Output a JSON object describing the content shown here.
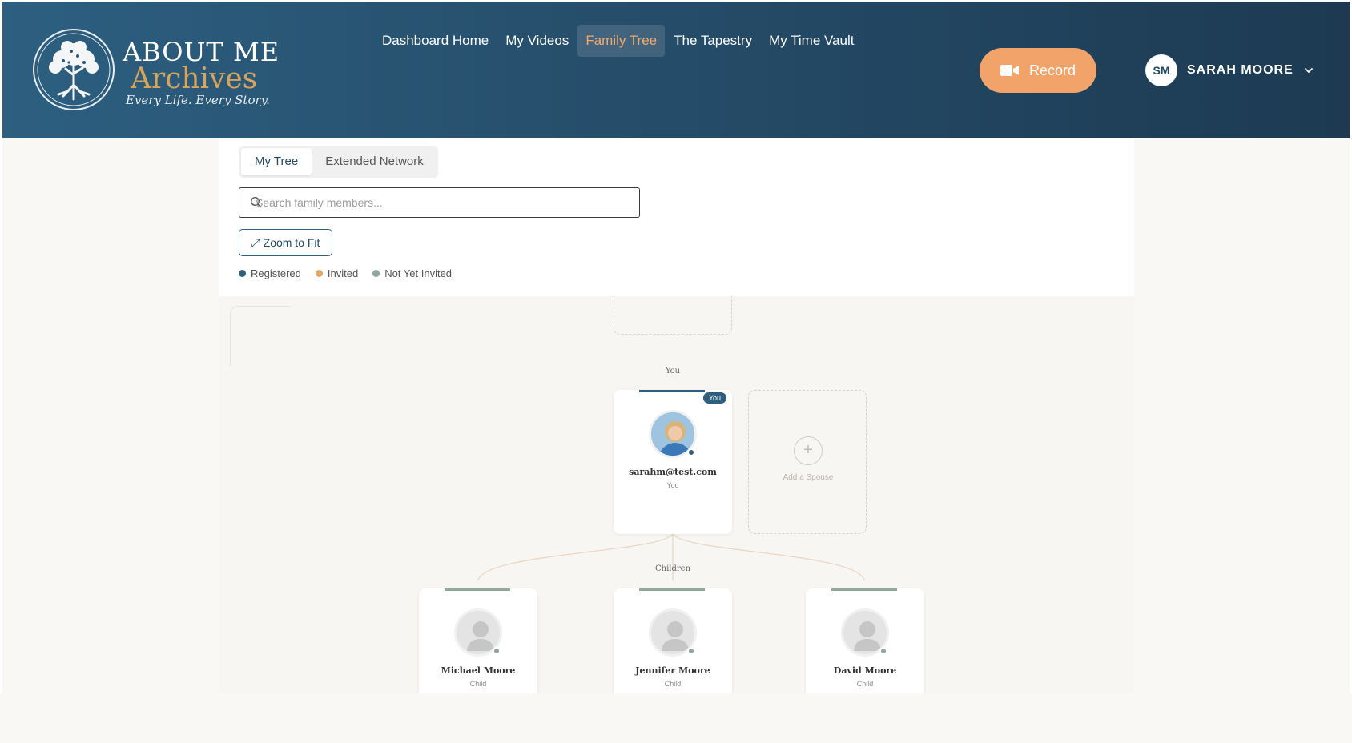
{
  "brand": {
    "line1": "ABOUT ME",
    "line2": "Archives",
    "tagline": "Every Life. Every Story."
  },
  "nav": {
    "items": [
      {
        "label": "Dashboard Home"
      },
      {
        "label": "My Videos"
      },
      {
        "label": "Family Tree",
        "active": true
      },
      {
        "label": "The Tapestry"
      },
      {
        "label": "My Time Vault"
      }
    ]
  },
  "record": {
    "label": "Record",
    "icon": "video-camera-icon"
  },
  "user": {
    "initials": "SM",
    "name": "SARAH MOORE",
    "menu_icon": "chevron-down-icon"
  },
  "tree": {
    "tabs": [
      {
        "label": "My Tree",
        "active": true
      },
      {
        "label": "Extended Network"
      }
    ],
    "search": {
      "placeholder": "Search family members..."
    },
    "zoom_label": "⤢ Zoom to Fit",
    "legend": [
      {
        "label": "Registered",
        "color": "#2f5f7e"
      },
      {
        "label": "Invited",
        "color": "#e0a868"
      },
      {
        "label": "Not Yet Invited",
        "color": "#8fa89b"
      }
    ],
    "you_section_label": "You",
    "children_section_label": "Children",
    "self_card": {
      "name": "sarahm@test.com",
      "role": "You",
      "badge": "You",
      "status": "Registered"
    },
    "add_spouse_label": "Add a Spouse",
    "children": [
      {
        "name": "Michael Moore",
        "role": "Child",
        "status": "Not Yet Invited"
      },
      {
        "name": "Jennifer Moore",
        "role": "Child",
        "status": "Not Yet Invited"
      },
      {
        "name": "David Moore",
        "role": "Child",
        "status": "Not Yet Invited"
      }
    ]
  },
  "colors": {
    "header": "#244a66",
    "accent": "#f2a36a",
    "registered": "#2f5f7e",
    "invited": "#e0a868",
    "not_invited": "#8fa89b"
  }
}
